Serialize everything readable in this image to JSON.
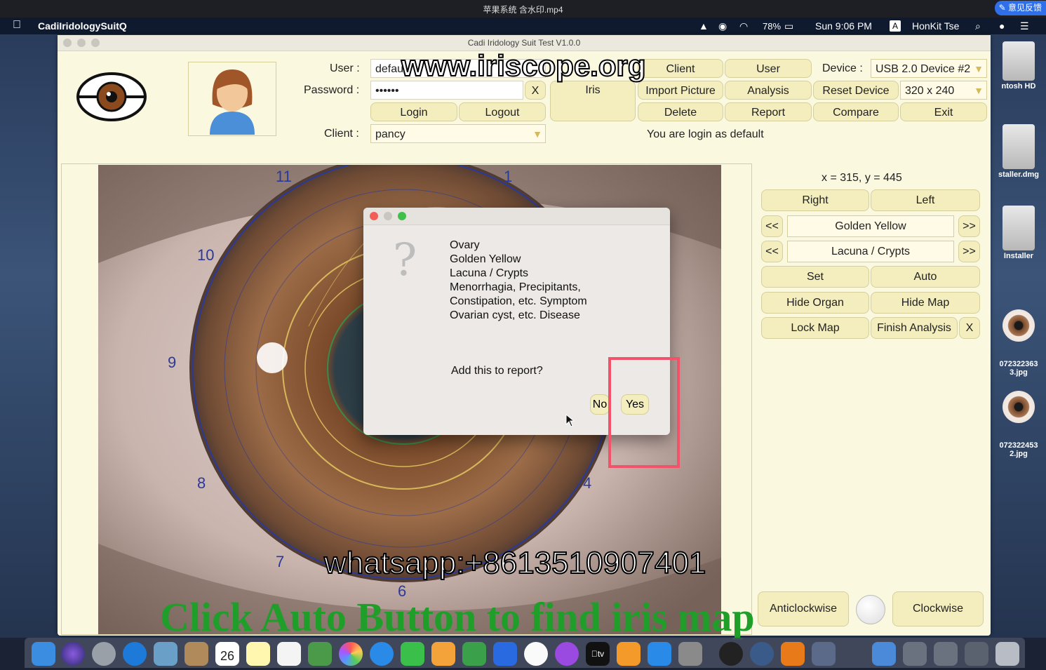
{
  "player": {
    "title": "苹果系统 含水印.mp4",
    "feedback": "意见反馈"
  },
  "menubar": {
    "app_name": "CadiIridologySuitQ",
    "battery": "78%",
    "datetime": "Sun 9:06 PM",
    "input_source": "A",
    "user": "HonKit Tse"
  },
  "desktop": {
    "icons": [
      {
        "label": "ntosh HD"
      },
      {
        "label": "staller.dmg"
      },
      {
        "label": "Installer"
      },
      {
        "label": "072322363\n3.jpg"
      },
      {
        "label": "072322453\n2.jpg"
      }
    ]
  },
  "window": {
    "title": "Cadi Iridology Suit Test V1.0.0",
    "login": {
      "user_label": "User :",
      "user_value": "defau",
      "password_label": "Password :",
      "password_value": "••••••",
      "clear_label": "X",
      "login_label": "Login",
      "logout_label": "Logout",
      "client_label": "Client :",
      "client_value": "pancy"
    },
    "toolbar": {
      "iris": "Iris",
      "client": "Client",
      "user": "User",
      "import_picture": "Import Picture",
      "analysis": "Analysis",
      "delete": "Delete",
      "report": "Report",
      "reset_device": "Reset Device",
      "compare": "Compare",
      "exit": "Exit",
      "device_label": "Device :",
      "device_value": "USB 2.0 Device #2",
      "resolution_value": "320 x 240"
    },
    "status": "You are login as default",
    "coords": "x = 315, y = 445",
    "side": {
      "right": "Right",
      "left": "Left",
      "prev": "<<",
      "next": ">>",
      "color_value": "Golden Yellow",
      "sign_value": "Lacuna / Crypts",
      "set": "Set",
      "auto": "Auto",
      "hide_organ": "Hide Organ",
      "hide_map": "Hide Map",
      "lock_map": "Lock Map",
      "finish_analysis": "Finish Analysis",
      "close": "X",
      "anticlockwise": "Anticlockwise",
      "clockwise": "Clockwise"
    },
    "clock_numbers": [
      "11",
      "1",
      "10",
      "9",
      "8",
      "4",
      "7",
      "6"
    ]
  },
  "dialog": {
    "lines": [
      "Ovary",
      "Golden Yellow",
      "Lacuna / Crypts",
      "Menorrhagia, Precipitants,",
      "Constipation, etc. Symptom",
      "Ovarian cyst, etc. Disease"
    ],
    "question": "Add this to report?",
    "no": "No",
    "yes": "Yes"
  },
  "watermarks": {
    "site": "www.iriscope.org",
    "phone": "whatsapp:+8613510907401",
    "caption": "Click Auto Button to find iris map"
  },
  "dock": {
    "calendar_day": "26",
    "tv_label": "tv"
  }
}
